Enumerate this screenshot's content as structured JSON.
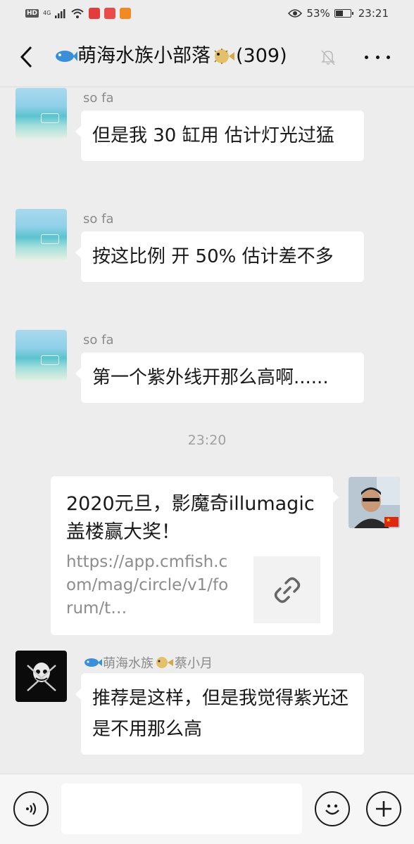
{
  "status_bar": {
    "network_badge": "HD",
    "network_type": "4G",
    "battery_percent": "53%",
    "battery_level": 0.53,
    "time": "23:21"
  },
  "header": {
    "title_prefix_icon": "fish-emoji",
    "title": "萌海水族小部落",
    "title_suffix_icon": "pufferfish-emoji",
    "member_count": "(309)"
  },
  "messages": [
    {
      "sender": "so fa",
      "text": "但是我 30 缸用 估计灯光过猛",
      "side": "left",
      "avatar": "beach-avatar"
    },
    {
      "sender": "so fa",
      "text": "按这比例 开 50% 估计差不多",
      "side": "left",
      "avatar": "beach-avatar"
    },
    {
      "sender": "so fa",
      "text": "第一个紫外线开那么高啊......",
      "side": "left",
      "avatar": "beach-avatar"
    }
  ],
  "time_divider": "23:20",
  "link_message": {
    "title": "2020元旦，影魔奇illumagic盖楼赢大奖！",
    "url": "https://app.cmfish.com/mag/circle/v1/forum/t…",
    "thumb_icon": "link-icon",
    "side": "right"
  },
  "last_message": {
    "sender_prefix": "萌海水族",
    "sender_name": "蔡小月",
    "text": "推荐是这样，但是我觉得紫光还是不用那么高",
    "side": "left"
  },
  "input_bar": {
    "placeholder": "",
    "voice_icon": "voice-icon",
    "emoji_icon": "emoji-icon",
    "plus_icon": "plus-icon"
  }
}
